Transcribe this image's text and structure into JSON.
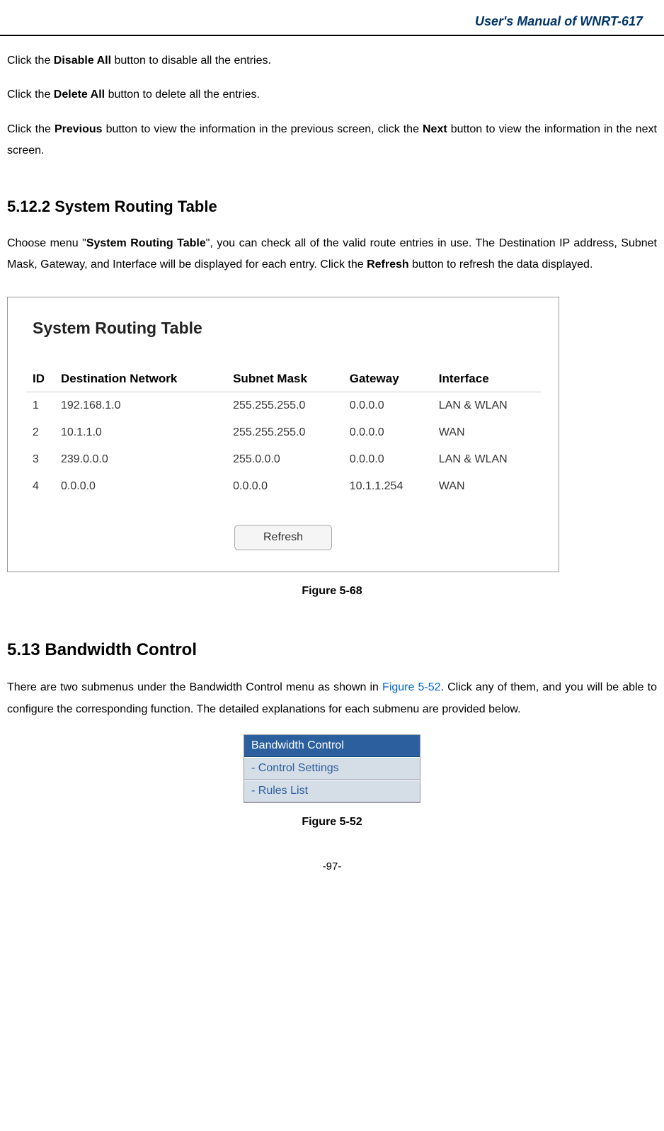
{
  "header": {
    "title": "User's Manual of WNRT-617"
  },
  "paragraphs": {
    "p1_a": "Click the ",
    "p1_bold": "Disable All",
    "p1_b": " button to disable all the entries.",
    "p2_a": "Click the ",
    "p2_bold": "Delete All",
    "p2_b": " button to delete all the entries.",
    "p3_a": "Click the ",
    "p3_bold1": "Previous",
    "p3_b": " button to view the information in the previous screen, click the ",
    "p3_bold2": "Next",
    "p3_c": " button to view the information in the next screen."
  },
  "section512": {
    "heading": "5.12.2  System Routing Table",
    "p_a": "Choose menu \"",
    "p_bold1": "System Routing Table",
    "p_b": "\", you can check all of the valid route entries in use. The Destination IP address, Subnet Mask, Gateway, and Interface will be displayed for each entry. Click the ",
    "p_bold2": "Refresh",
    "p_c": " button to refresh the data displayed."
  },
  "routingTable": {
    "title": "System Routing Table",
    "headers": {
      "id": "ID",
      "dest": "Destination Network",
      "mask": "Subnet Mask",
      "gateway": "Gateway",
      "iface": "Interface"
    },
    "rows": [
      {
        "id": "1",
        "dest": "192.168.1.0",
        "mask": "255.255.255.0",
        "gateway": "0.0.0.0",
        "iface": "LAN & WLAN"
      },
      {
        "id": "2",
        "dest": "10.1.1.0",
        "mask": "255.255.255.0",
        "gateway": "0.0.0.0",
        "iface": "WAN"
      },
      {
        "id": "3",
        "dest": "239.0.0.0",
        "mask": "255.0.0.0",
        "gateway": "0.0.0.0",
        "iface": "LAN & WLAN"
      },
      {
        "id": "4",
        "dest": "0.0.0.0",
        "mask": "0.0.0.0",
        "gateway": "10.1.1.254",
        "iface": "WAN"
      }
    ],
    "refreshLabel": "Refresh",
    "caption": "Figure 5-68"
  },
  "section513": {
    "heading": "5.13  Bandwidth Control",
    "p_a": "There are two submenus under the Bandwidth Control menu as shown in ",
    "p_link": "Figure 5-52",
    "p_b": ". Click any of them, and you will be able to configure the corresponding function. The detailed explanations for each submenu are provided below."
  },
  "menu": {
    "header": "Bandwidth Control",
    "item1": "- Control Settings",
    "item2": "- Rules List",
    "caption": "Figure 5-52"
  },
  "footer": {
    "pageNum": "-97-"
  }
}
